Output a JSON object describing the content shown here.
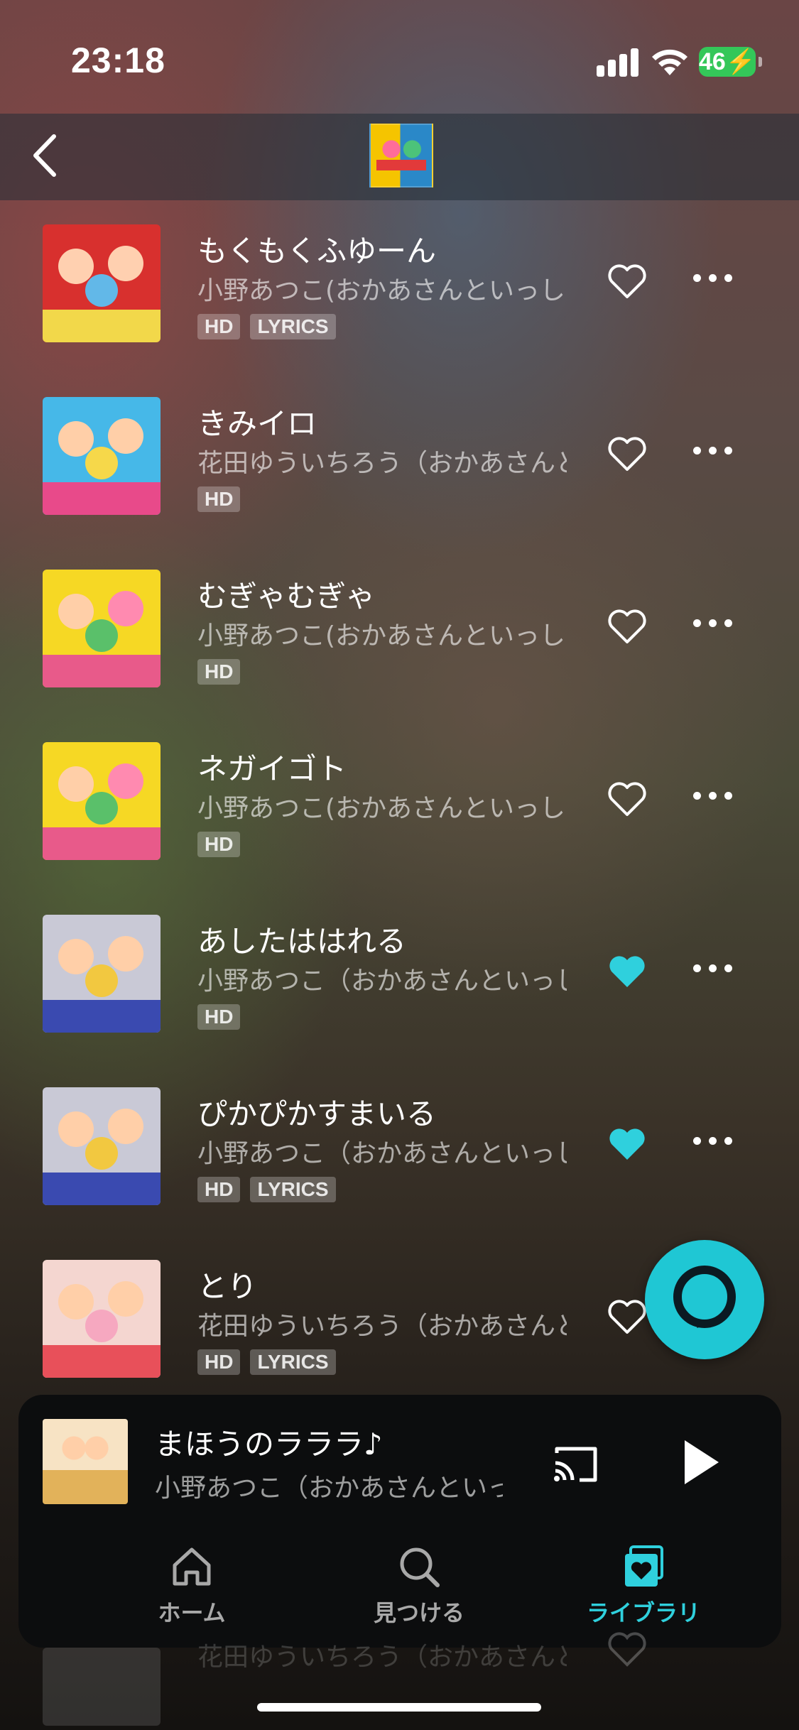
{
  "status": {
    "time": "23:18",
    "battery": "46"
  },
  "tracks": [
    {
      "title": "もくもくふゆーん",
      "artist": "小野あつこ(おかあさんといっしょ)…",
      "tags": [
        "HD",
        "LYRICS"
      ],
      "liked": false,
      "art": {
        "bg": "#d8302e",
        "band": "#f2d84a",
        "c1": "#ffd0b0",
        "c2": "#ffd0b0",
        "c3": "#62b8e8"
      }
    },
    {
      "title": "きみイロ",
      "artist": "花田ゆういちろう（おかあさんといっしょ）…",
      "tags": [
        "HD"
      ],
      "liked": false,
      "art": {
        "bg": "#46b8e8",
        "band": "#e84a8a",
        "c1": "#ffcfa8",
        "c2": "#ffcfa8",
        "c3": "#f6d84a"
      }
    },
    {
      "title": "むぎゃむぎゃ",
      "artist": "小野あつこ(おかあさんといっしょ)…",
      "tags": [
        "HD"
      ],
      "liked": false,
      "art": {
        "bg": "#f6d824",
        "band": "#e85a8a",
        "c1": "#ffcfa8",
        "c2": "#ff8ab0",
        "c3": "#5ac06a"
      }
    },
    {
      "title": "ネガイゴト",
      "artist": "小野あつこ(おかあさんといっしょ)…",
      "tags": [
        "HD"
      ],
      "liked": false,
      "art": {
        "bg": "#f6d824",
        "band": "#e85a8a",
        "c1": "#ffcfa8",
        "c2": "#ff8ab0",
        "c3": "#5ac06a"
      }
    },
    {
      "title": "あしたははれる",
      "artist": "小野あつこ（おかあさんといっしょ）…",
      "tags": [
        "HD"
      ],
      "liked": true,
      "art": {
        "bg": "#c9c9d6",
        "band": "#3a4ab0",
        "c1": "#ffcfa8",
        "c2": "#ffcfa8",
        "c3": "#f2c840"
      }
    },
    {
      "title": "ぴかぴかすまいる",
      "artist": "小野あつこ（おかあさんといっしょ）…",
      "tags": [
        "HD",
        "LYRICS"
      ],
      "liked": true,
      "art": {
        "bg": "#c9c9d6",
        "band": "#3a4ab0",
        "c1": "#ffcfa8",
        "c2": "#ffcfa8",
        "c3": "#f2c840"
      }
    },
    {
      "title": "とり",
      "artist": "花田ゆういちろう（おかあさんといっしょ）…",
      "tags": [
        "HD",
        "LYRICS"
      ],
      "liked": false,
      "art": {
        "bg": "#f4d6d0",
        "band": "#e8505a",
        "c1": "#ffcfa8",
        "c2": "#ffcfa8",
        "c3": "#f6a8c0"
      }
    }
  ],
  "now_playing": {
    "title": "まほうのラララ♪",
    "artist": "小野あつこ（おかあさんといっしょ）…"
  },
  "nav": {
    "home": "ホーム",
    "find": "見つける",
    "library": "ライブラリ"
  },
  "behind": {
    "artist": "花田ゆういちろう（おかあさんといっしょ）"
  },
  "colors": {
    "accent": "#2fd0dd",
    "alexa": "#1fc7d4",
    "battery": "#34c759"
  }
}
